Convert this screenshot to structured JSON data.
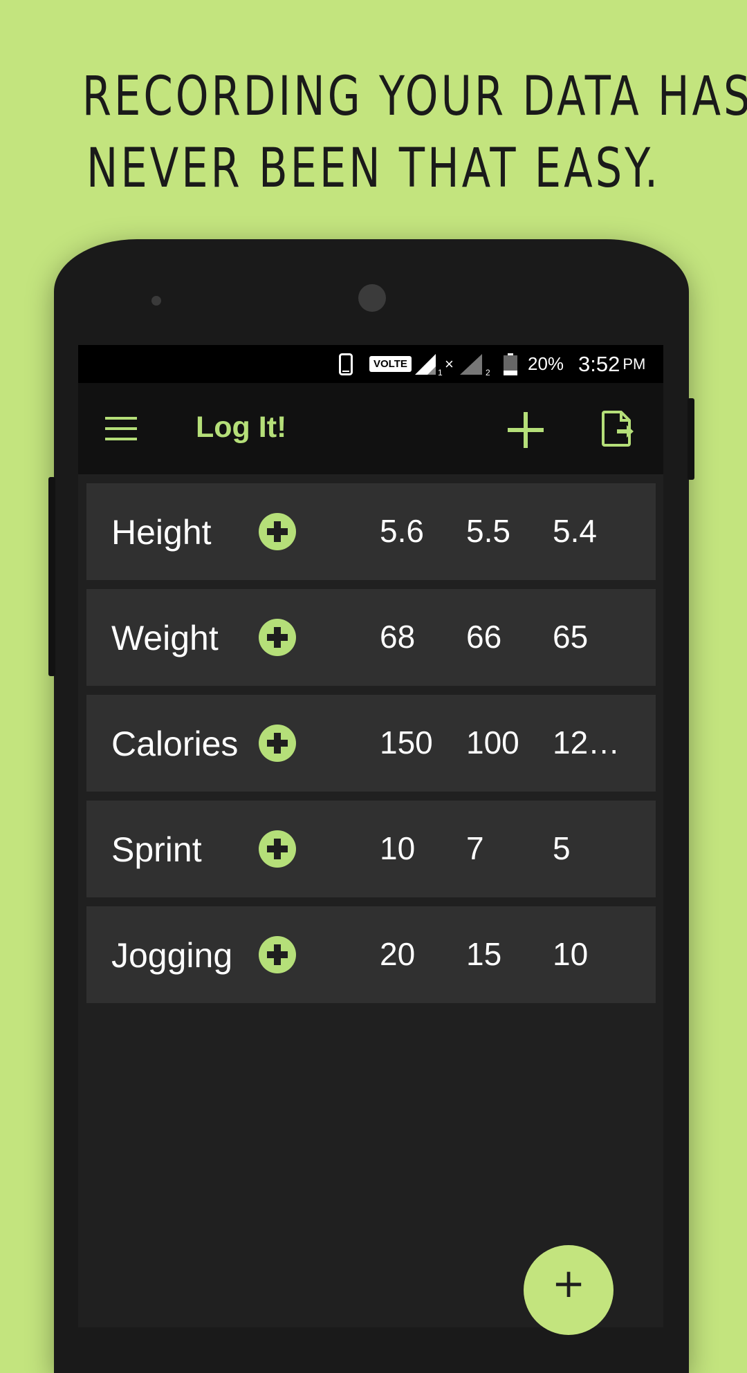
{
  "headline": {
    "line1": "RECORDING YOUR DATA HAS",
    "line2": "NEVER BEEN THAT EASY."
  },
  "status_bar": {
    "network_badge": "VOLTE",
    "sim1_label": "1",
    "sim2_label": "2",
    "no_service_mark": "×",
    "battery": "20%",
    "time": "3:52",
    "ampm": "PM",
    "icons": [
      "phone-icon",
      "signal-icon",
      "battery-icon"
    ]
  },
  "toolbar": {
    "title": "Log It!",
    "icons": [
      "menu-icon",
      "add-icon",
      "export-icon"
    ]
  },
  "entries": [
    {
      "label": "Height",
      "values": [
        "5.6",
        "5.5",
        "5.4"
      ]
    },
    {
      "label": "Weight",
      "values": [
        "68",
        "66",
        "65"
      ]
    },
    {
      "label": "Calories",
      "values": [
        "150",
        "100",
        "12…"
      ]
    },
    {
      "label": "Sprint",
      "values": [
        "10",
        "7",
        "5"
      ]
    },
    {
      "label": "Jogging",
      "values": [
        "20",
        "15",
        "10"
      ]
    }
  ],
  "fab": {
    "label": "+"
  },
  "colors": {
    "background": "#c3e47e",
    "accent": "#b5df79",
    "toolbar": "#111111",
    "row": "#303030",
    "screen": "#202020"
  }
}
